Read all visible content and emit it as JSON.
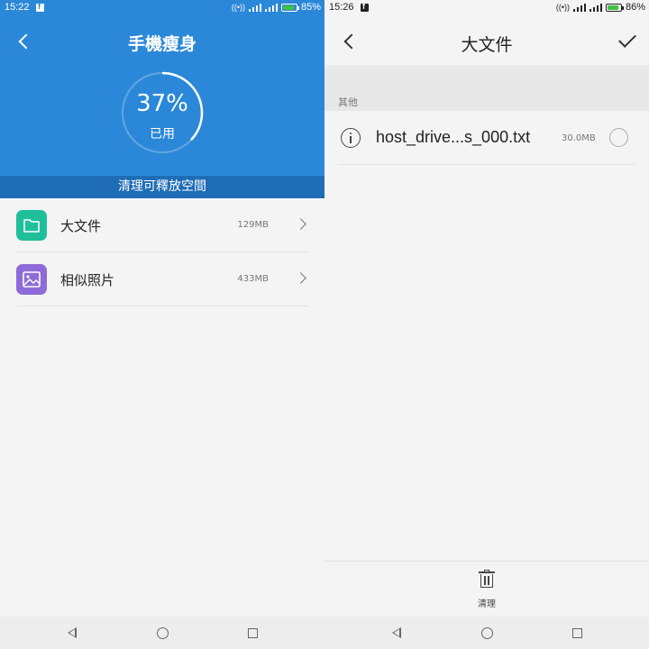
{
  "left": {
    "status": {
      "time": "15:22",
      "battery": "85%",
      "battery_level": 0.85
    },
    "title": "手機瘦身",
    "usage": {
      "percent_label": "37%",
      "used_label": "已用",
      "fraction": 0.37
    },
    "clean_banner": "清理可釋放空間",
    "items": [
      {
        "label": "大文件",
        "size": "129MB",
        "icon": "folder-icon",
        "color": "#1fbf9b"
      },
      {
        "label": "相似照片",
        "size": "433MB",
        "icon": "image-icon",
        "color": "#8e6bd8"
      }
    ],
    "colors": {
      "header": "#2b88d8",
      "strip": "#1f6db6"
    }
  },
  "right": {
    "status": {
      "time": "15:26",
      "battery": "86%",
      "battery_level": 0.86
    },
    "title": "大文件",
    "section": "其他",
    "file": {
      "name": "host_drive...s_000.txt",
      "size": "30.0MB"
    },
    "action_label": "清理"
  }
}
